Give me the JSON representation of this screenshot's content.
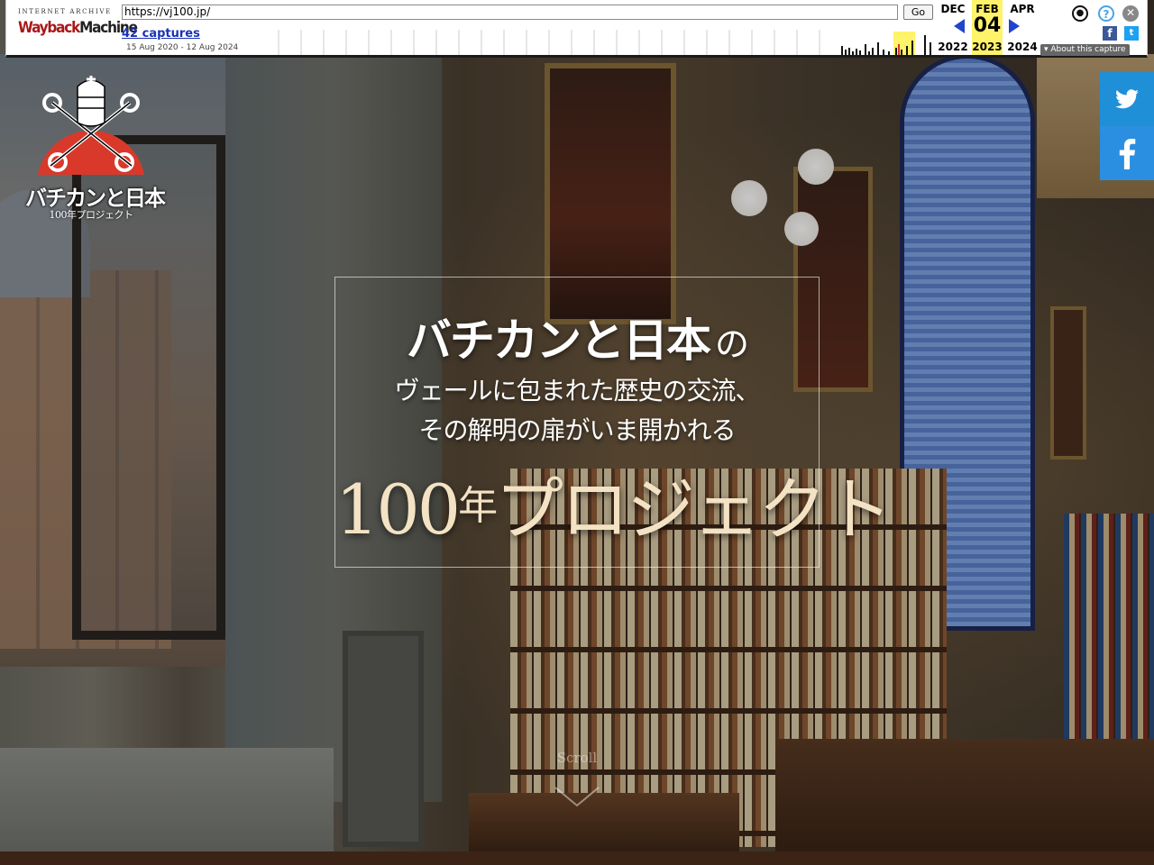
{
  "wayback": {
    "brand_top": "INTERNET ARCHIVE",
    "brand_main_a": "Wayback",
    "brand_main_b": "Machine",
    "url": "https://vj100.jp/",
    "go_label": "Go",
    "captures_label": "42 captures",
    "date_range": "15 Aug 2020 - 12 Aug 2024",
    "prev": {
      "month": "DEC",
      "year": "2022"
    },
    "current": {
      "month": "FEB",
      "day": "04",
      "year": "2023"
    },
    "next": {
      "month": "APR",
      "year": "2024"
    },
    "about_label": "About this capture",
    "icons": [
      "user-icon",
      "help-icon",
      "close-icon",
      "facebook-icon",
      "twitter-icon"
    ]
  },
  "site": {
    "logo_title": "バチカンと日本",
    "logo_sub": "100年プロジェクト",
    "headline_a": "バチカンと日本",
    "headline_b": "の",
    "line2": "ヴェールに包まれた歴史の交流、",
    "line3": "その解明の扉がいま開かれる",
    "project_num": "100",
    "project_nen": "年",
    "project_word": "プロジェクト",
    "scroll_label": "Scroll",
    "social": {
      "twitter": "twitter-icon",
      "facebook": "facebook-icon"
    }
  },
  "colors": {
    "accent_red": "#d8392b",
    "twitter_blue": "#1f8fd8",
    "wayback_highlight": "#fff36a",
    "wayback_arrow": "#2244cc"
  }
}
